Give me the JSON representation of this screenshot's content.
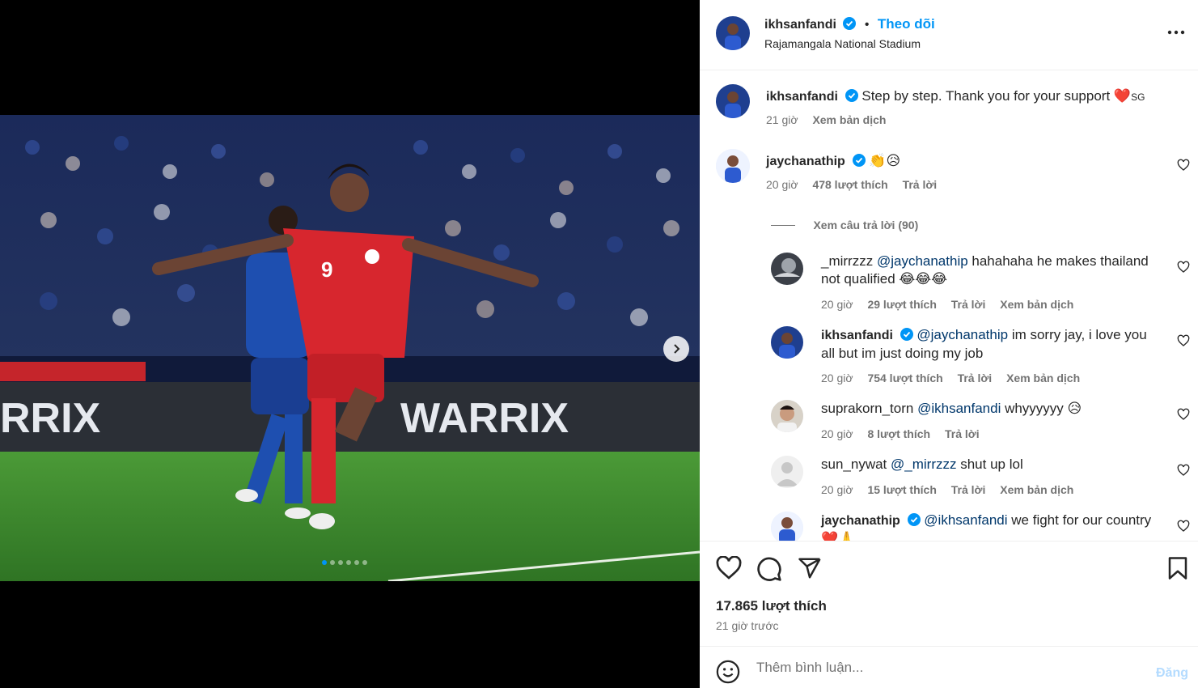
{
  "post": {
    "author": "ikhsanfandi",
    "follow_label": "Theo dõi",
    "separator": "•",
    "location": "Rajamangala National Stadium",
    "more_icon": "more-horizontal-icon",
    "caption": "Step by step. Thank you for your support ❤️",
    "caption_suffix": "SG",
    "caption_time": "21 giờ",
    "translate_label": "Xem bản dịch",
    "image_alt_banner": "WARRIX",
    "carousel_count": 6
  },
  "comments": [
    {
      "user": "jaychanathip",
      "verified": true,
      "mention": "",
      "text": "👏😥",
      "time": "20 giờ",
      "likes": "478 lượt thích",
      "reply": "Trả lời",
      "translate": "",
      "view_replies": "Xem câu trả lời (90)"
    },
    {
      "user": "_mirrzzz",
      "verified": false,
      "mention": "@jaychanathip",
      "text": " hahahaha he makes thailand not qualified 😂😂😂",
      "time": "20 giờ",
      "likes": "29 lượt thích",
      "reply": "Trả lời",
      "translate": "Xem bản dịch"
    },
    {
      "user": "ikhsanfandi",
      "verified": true,
      "mention": "@jaychanathip",
      "text": " im sorry jay, i love you all but im just doing my job",
      "time": "20 giờ",
      "likes": "754 lượt thích",
      "reply": "Trả lời",
      "translate": "Xem bản dịch"
    },
    {
      "user": "suprakorn_torn",
      "verified": false,
      "mention": "@ikhsanfandi",
      "text": " whyyyyyy 😥",
      "time": "20 giờ",
      "likes": "8 lượt thích",
      "reply": "Trả lời",
      "translate": ""
    },
    {
      "user": "sun_nywat",
      "verified": false,
      "mention": "@_mirrzzz",
      "text": " shut up lol",
      "time": "20 giờ",
      "likes": "15 lượt thích",
      "reply": "Trả lời",
      "translate": "Xem bản dịch"
    },
    {
      "user": "jaychanathip",
      "verified": true,
      "mention": "@ikhsanfandi",
      "text": " we fight for our country ❤️🙏",
      "time": "",
      "likes": "",
      "reply": "",
      "translate": ""
    }
  ],
  "footer": {
    "likes_count": "17.865 lượt thích",
    "time_ago": "21 giờ trước",
    "comment_placeholder": "Thêm bình luận...",
    "post_label": "Đăng"
  },
  "colors": {
    "accent": "#0095f6",
    "verified": "#0095f6",
    "mention": "#00376b",
    "jersey_red": "#d7262e",
    "jersey_blue": "#1e4fb0",
    "pitch": "#3f8a2e"
  }
}
